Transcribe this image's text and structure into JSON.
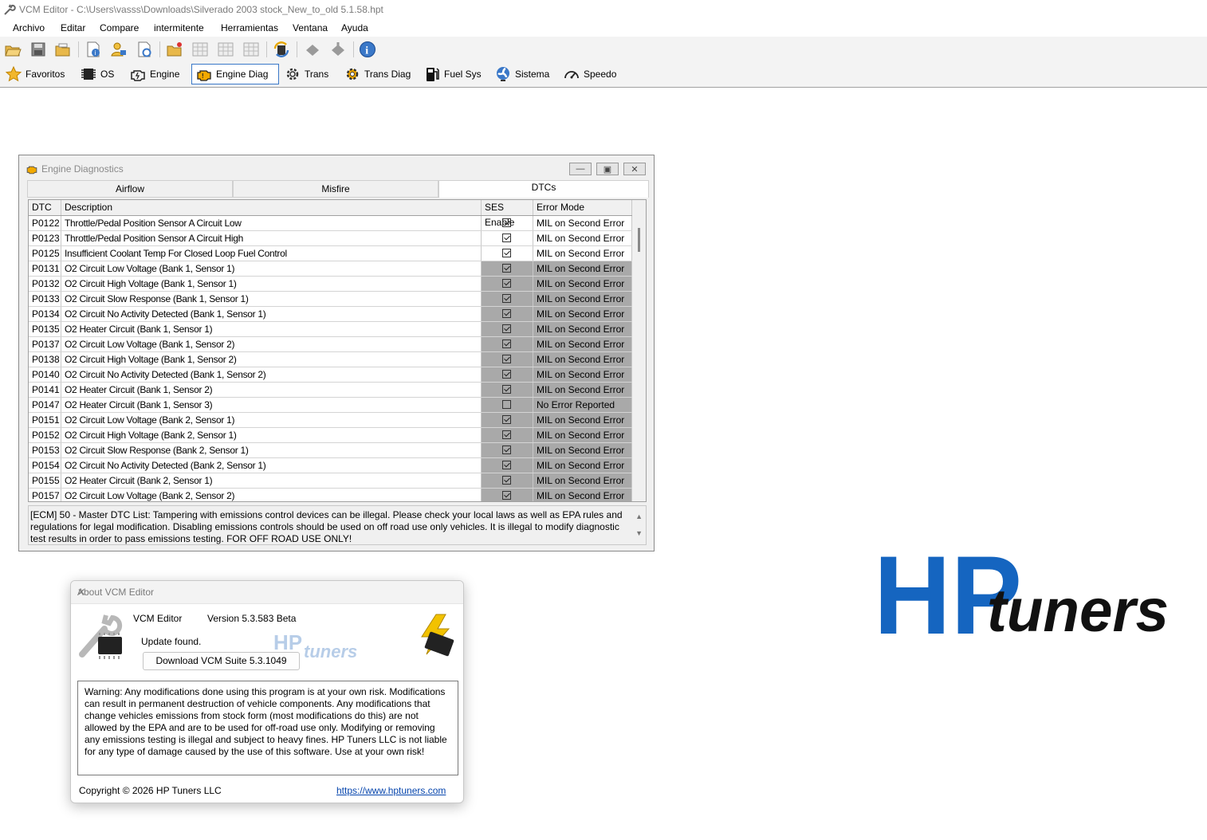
{
  "window": {
    "title": "VCM Editor - C:\\Users\\vasss\\Downloads\\Silverado 2003 stock_New_to_old 5.1.58.hpt"
  },
  "menu": [
    "Archivo",
    "Editar",
    "Compare",
    "intermitente",
    "Herramientas",
    "Ventana",
    "Ayuda"
  ],
  "toolbar_icons": [
    "open-icon",
    "save-icon",
    "open-folder-icon",
    "file-info-icon",
    "user-key-icon",
    "file-settings-icon",
    "new-folder-icon",
    "table-icon",
    "table-icon",
    "table-icon",
    "convert-icon",
    "write-icon",
    "read-icon",
    "info-icon"
  ],
  "nav": {
    "favoritos": "Favoritos",
    "os": "OS",
    "engine": "Engine",
    "engine_diag": "Engine Diag",
    "trans": "Trans",
    "trans_diag": "Trans Diag",
    "fuel_sys": "Fuel Sys",
    "sistema": "Sistema",
    "speedo": "Speedo"
  },
  "diag": {
    "title": "Engine Diagnostics",
    "tabs": [
      "Airflow",
      "Misfire",
      "DTCs"
    ],
    "columns": [
      "DTC",
      "Description",
      "SES Enable",
      "Error Mode"
    ],
    "rows": [
      {
        "dtc": "P0122",
        "desc": "Throttle/Pedal Position Sensor A Circuit Low",
        "ses": true,
        "mode": "MIL on Second Error",
        "grey": false
      },
      {
        "dtc": "P0123",
        "desc": "Throttle/Pedal Position Sensor A Circuit High",
        "ses": true,
        "mode": "MIL on Second Error",
        "grey": false
      },
      {
        "dtc": "P0125",
        "desc": "Insufficient Coolant Temp For Closed Loop Fuel Control",
        "ses": true,
        "mode": "MIL on Second Error",
        "grey": false
      },
      {
        "dtc": "P0131",
        "desc": "O2 Circuit Low Voltage (Bank 1, Sensor 1)",
        "ses": true,
        "mode": "MIL on Second Error",
        "grey": true
      },
      {
        "dtc": "P0132",
        "desc": "O2 Circuit High Voltage (Bank 1, Sensor 1)",
        "ses": true,
        "mode": "MIL on Second Error",
        "grey": true
      },
      {
        "dtc": "P0133",
        "desc": "O2 Circuit Slow Response (Bank 1, Sensor 1)",
        "ses": true,
        "mode": "MIL on Second Error",
        "grey": true
      },
      {
        "dtc": "P0134",
        "desc": "O2 Circuit No Activity Detected (Bank 1, Sensor 1)",
        "ses": true,
        "mode": "MIL on Second Error",
        "grey": true
      },
      {
        "dtc": "P0135",
        "desc": "O2 Heater Circuit (Bank 1, Sensor 1)",
        "ses": true,
        "mode": "MIL on Second Error",
        "grey": true
      },
      {
        "dtc": "P0137",
        "desc": "O2 Circuit Low Voltage (Bank 1, Sensor 2)",
        "ses": true,
        "mode": "MIL on Second Error",
        "grey": true
      },
      {
        "dtc": "P0138",
        "desc": "O2 Circuit High Voltage (Bank 1, Sensor 2)",
        "ses": true,
        "mode": "MIL on Second Error",
        "grey": true
      },
      {
        "dtc": "P0140",
        "desc": "O2 Circuit No Activity Detected (Bank 1, Sensor 2)",
        "ses": true,
        "mode": "MIL on Second Error",
        "grey": true
      },
      {
        "dtc": "P0141",
        "desc": "O2 Heater Circuit (Bank 1, Sensor 2)",
        "ses": true,
        "mode": "MIL on Second Error",
        "grey": true
      },
      {
        "dtc": "P0147",
        "desc": "O2 Heater Circuit (Bank 1, Sensor 3)",
        "ses": false,
        "mode": "No Error Reported",
        "grey": true
      },
      {
        "dtc": "P0151",
        "desc": "O2 Circuit Low Voltage (Bank 2, Sensor 1)",
        "ses": true,
        "mode": "MIL on Second Error",
        "grey": true
      },
      {
        "dtc": "P0152",
        "desc": "O2 Circuit High Voltage (Bank 2, Sensor 1)",
        "ses": true,
        "mode": "MIL on Second Error",
        "grey": true
      },
      {
        "dtc": "P0153",
        "desc": "O2 Circuit Slow Response (Bank 2, Sensor 1)",
        "ses": true,
        "mode": "MIL on Second Error",
        "grey": true
      },
      {
        "dtc": "P0154",
        "desc": "O2 Circuit No Activity Detected (Bank 2, Sensor 1)",
        "ses": true,
        "mode": "MIL on Second Error",
        "grey": true
      },
      {
        "dtc": "P0155",
        "desc": "O2 Heater Circuit (Bank 2, Sensor 1)",
        "ses": true,
        "mode": "MIL on Second Error",
        "grey": true
      },
      {
        "dtc": "P0157",
        "desc": "O2 Circuit Low Voltage (Bank 2, Sensor 2)",
        "ses": true,
        "mode": "MIL on Second Error",
        "grey": true
      }
    ],
    "note": "[ECM] 50 - Master DTC List: Tampering with emissions control devices can be illegal. Please check your local laws as well as EPA rules and regulations for legal modification. Disabling emissions controls should be used on off road use only vehicles. It is illegal to modify diagnostic test results in order to pass emissions testing. FOR OFF ROAD USE ONLY!"
  },
  "about": {
    "title": "About VCM Editor",
    "app_name": "VCM Editor",
    "version": "Version 5.3.583 Beta",
    "update": "Update found.",
    "download": "Download VCM Suite 5.3.1049",
    "warning": "Warning: Any modifications done using this program is at your own risk. Modifications can result in permanent destruction of vehicle components. Any modifications that change vehicles emissions from stock form (most modifications do this) are not allowed by the EPA and are to be used for off-road use only. Modifying or removing any emissions testing is illegal and subject to heavy fines. HP Tuners LLC is not liable for any type of damage caused by the use of this software. Use at your own risk!",
    "copyright": "Copyright © 2026 HP Tuners LLC",
    "link": "https://www.hptuners.com"
  },
  "logo": {
    "hp": "HP",
    "tuners": "tuners",
    "color": "#1565c0"
  }
}
